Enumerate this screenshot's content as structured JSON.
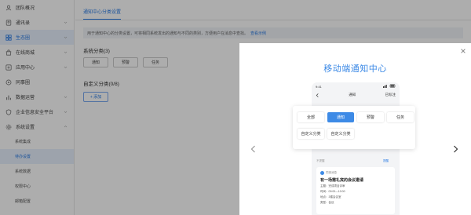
{
  "sidebar": {
    "items": [
      {
        "label": "团队概况",
        "icon": "team-icon",
        "expandable": false
      },
      {
        "label": "通讯录",
        "icon": "contacts-icon",
        "expandable": true
      },
      {
        "label": "生态圈",
        "icon": "ecosystem-icon",
        "expandable": true,
        "active": true
      },
      {
        "label": "在线商城",
        "icon": "store-icon",
        "expandable": true
      },
      {
        "label": "应用中心",
        "icon": "apps-icon",
        "expandable": true
      },
      {
        "label": "同事圈",
        "icon": "colleague-icon",
        "expandable": false
      },
      {
        "label": "数据运营",
        "icon": "data-icon",
        "expandable": true
      },
      {
        "label": "企业信息安全平台",
        "icon": "security-icon",
        "expandable": true
      },
      {
        "label": "系统设置",
        "icon": "settings-icon",
        "expandable": true,
        "expanded": true
      }
    ],
    "sub_items": [
      {
        "label": "系统集成"
      },
      {
        "label": "待办设置",
        "active": true
      },
      {
        "label": "系统数据"
      },
      {
        "label": "权限中心"
      },
      {
        "label": "邮箱配置"
      }
    ]
  },
  "main": {
    "active_tab": "通知中心分类设置",
    "description": "用于通知中心的分类设置，可将相同系统发出的通知与不同的类别，方便用户在消息中查找。",
    "description_link": "查看示例",
    "system_section_title": "系统分类(3)",
    "system_tags": [
      "通知",
      "预警",
      "任务"
    ],
    "custom_section_title": "自定义分类(0/8)",
    "add_button": "+ 添加"
  },
  "modal": {
    "title": "移动端通知中心",
    "phone": {
      "time": "9:41",
      "header_title": "通知",
      "header_action": "已标注",
      "hint_left": "不提醒",
      "hint_right": "提醒",
      "card_app": "同事消息",
      "card_title": "有一场需礼宾的会议邀请",
      "card_lines": [
        "主题：完成项目评审",
        "时间：09:00—10:00",
        "地点：3楼会议室",
        "类型：会议"
      ]
    },
    "categories": [
      {
        "label": "全部",
        "selected": false
      },
      {
        "label": "通知",
        "selected": true
      },
      {
        "label": "预警",
        "selected": false
      },
      {
        "label": "任务",
        "selected": false
      },
      {
        "label": "自定义分类",
        "selected": false
      },
      {
        "label": "自定义分类",
        "selected": false
      }
    ]
  },
  "colors": {
    "accent": "#2a7be4",
    "modal_title": "#3d8ae6",
    "active_bg": "#e8f1fe",
    "overlay": "rgba(0,0,0,0.32)"
  }
}
